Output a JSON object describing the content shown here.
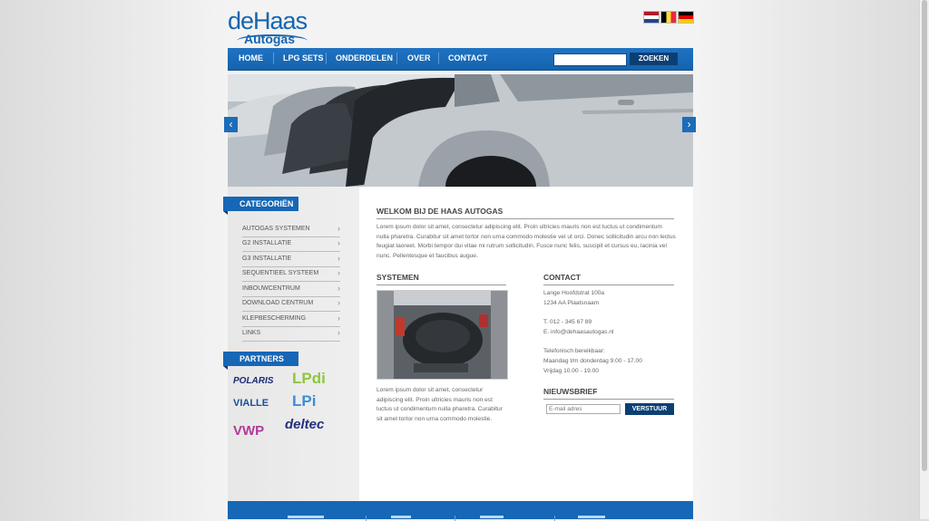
{
  "logo": {
    "brand": "deHaas",
    "sub": "Autogas"
  },
  "flags": [
    {
      "name": "dutch-flag-icon",
      "colors": [
        "#ae1c28",
        "#ffffff",
        "#21468b"
      ]
    },
    {
      "name": "belgian-flag-icon",
      "colors": [
        "#000000",
        "#fae042",
        "#ed2939"
      ]
    },
    {
      "name": "german-flag-icon",
      "colors": [
        "#000000",
        "#dd0000",
        "#ffce00"
      ]
    }
  ],
  "nav": {
    "items": [
      "HOME",
      "LPG SETS",
      "ONDERDELEN",
      "OVER",
      "CONTACT"
    ],
    "search_value": "",
    "search_button": "ZOEKEN"
  },
  "slider": {
    "prev_icon": "chevron-left-icon",
    "next_icon": "chevron-right-icon",
    "prev": "‹",
    "next": "›"
  },
  "sidebar": {
    "categories_title": "CATEGORIËN",
    "categories": [
      "AUTOGAS SYSTEMEN",
      "G2 INSTALLATIE",
      "G3 INSTALLATIE",
      "SEQUENTIEEL SYSTEEM",
      "INBOUWCENTRUM",
      "DOWNLOAD CENTRUM",
      "KLEPBESCHERMING",
      "LINKS"
    ],
    "partners_title": "PARTNERS",
    "partners": [
      "POLARIS",
      "LPdi",
      "VIALLE",
      "LPi",
      "VWP",
      "deltec"
    ]
  },
  "main": {
    "welcome_title": "WELKOM BIJ DE HAAS AUTOGAS",
    "welcome_text": "Lorem ipsum dolor sit amet, consectetur adipiscing elit. Proin ultricies mauris non est luctus ut condimentum nulla pharetra. Curabitur sit amet tortor non urna commodo molestie vel ut orci. Donec sollicitudin arcu non lectus feugiat laoreet. Morbi tempor dui vitae mi rutrum sollicitudin. Fusce nunc felis, suscipit et cursus eu, lacinia vel nunc. Pellentesque et faucibus augue.",
    "systems_title": "SYSTEMEN",
    "systems_text": "Lorem ipsum dolor sit amet, consectetur adipiscing elit. Proin ultricies mauris non est luctus ut condimentum nulla pharetra. Curabitur sit amet tortor non urna commodo molestie.",
    "contact_title": "CONTACT",
    "contact_lines": [
      "Lange Hoofdstrat 100a",
      "1234 AA Plaatsnaam",
      "T. 012 - 345 67 89",
      "E. info@dehaasautogas.nl",
      "Telefonisch bereikbaar:",
      "Maandag t/m donderdag 9.00 - 17.00",
      "Vrijdag 10.00 - 19.00"
    ],
    "newsletter_title": "NIEUWSBRIEF",
    "newsletter_placeholder": "E-mail adres",
    "newsletter_button": "VERSTUUR"
  },
  "colors": {
    "brand_blue": "#1667b5",
    "dark_blue": "#0b3f74"
  }
}
